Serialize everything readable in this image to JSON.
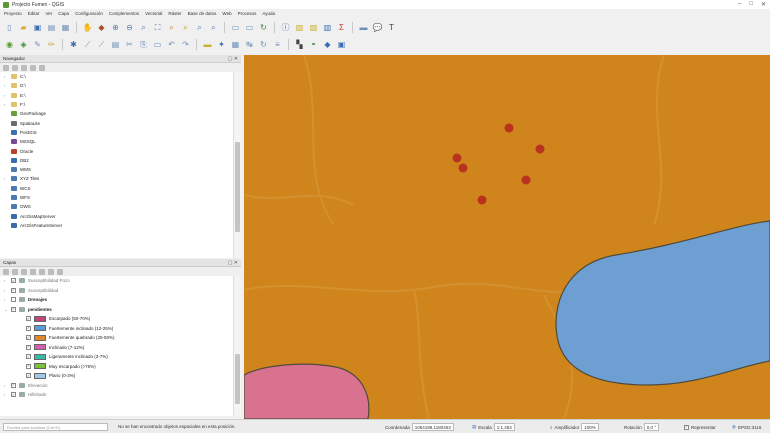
{
  "window": {
    "title": "Projecto Fumen - QGIS",
    "controls": [
      "–",
      "□",
      "✕"
    ]
  },
  "menu": [
    "Proyecto",
    "Editar",
    "Ver",
    "Capa",
    "Configuración",
    "Complementos",
    "Vectorial",
    "Ráster",
    "Base de datos",
    "Web",
    "Procesos",
    "Ayuda"
  ],
  "toolbar": {
    "row1": [
      {
        "icon": "new-project-icon",
        "glyph": "▯",
        "color": "#6d8fb8"
      },
      {
        "icon": "open-project-icon",
        "glyph": "▰",
        "color": "#d6a93a"
      },
      {
        "icon": "save-project-icon",
        "glyph": "▣",
        "color": "#3b6eb3"
      },
      {
        "icon": "print-layout-icon",
        "glyph": "▤",
        "color": "#6d8fb8"
      },
      {
        "icon": "layout-manager-icon",
        "glyph": "▦",
        "color": "#6d8fb8"
      },
      {
        "icon": "pan-icon",
        "glyph": "✋",
        "color": "#c9a33a"
      },
      {
        "icon": "pan-to-selection-icon",
        "glyph": "◆",
        "color": "#a94e2a"
      },
      {
        "icon": "zoom-in-icon",
        "glyph": "⊕",
        "color": "#5b80b0"
      },
      {
        "icon": "zoom-out-icon",
        "glyph": "⊖",
        "color": "#5b80b0"
      },
      {
        "icon": "zoom-rubber-icon",
        "glyph": "⌕",
        "color": "#5b80b0"
      },
      {
        "icon": "zoom-full-icon",
        "glyph": "⛶",
        "color": "#3a6ea8"
      },
      {
        "icon": "zoom-layer-icon",
        "glyph": "⌕",
        "color": "#c8862e"
      },
      {
        "icon": "zoom-selection-icon",
        "glyph": "⌕",
        "color": "#b8a22e"
      },
      {
        "icon": "zoom-last-icon",
        "glyph": "⌕",
        "color": "#5b80b0"
      },
      {
        "icon": "zoom-next-icon",
        "glyph": "⌕",
        "color": "#5b80b0"
      },
      {
        "icon": "new-bookmark-icon",
        "glyph": "▭",
        "color": "#6d8fb8"
      },
      {
        "icon": "show-bookmarks-icon",
        "glyph": "▭",
        "color": "#6d8fb8"
      },
      {
        "icon": "refresh-icon",
        "glyph": "↻",
        "color": "#3b8a3b"
      },
      {
        "icon": "identify-icon",
        "glyph": "ⓘ",
        "color": "#3a6ea8"
      },
      {
        "icon": "select-features-icon",
        "glyph": "▨",
        "color": "#c8b02e"
      },
      {
        "icon": "deselect-icon",
        "glyph": "▧",
        "color": "#c8b02e"
      },
      {
        "icon": "field-calculator-icon",
        "glyph": "▥",
        "color": "#3b6eb3"
      },
      {
        "icon": "statistics-icon",
        "glyph": "Σ",
        "color": "#c03a2a"
      },
      {
        "icon": "measure-icon",
        "glyph": "▬",
        "color": "#6d8fb8"
      },
      {
        "icon": "map-tips-icon",
        "glyph": "💬",
        "color": "#c9a33a"
      },
      {
        "icon": "text-annotation-icon",
        "glyph": "T",
        "color": "#444"
      }
    ],
    "row2": [
      {
        "icon": "data-source-manager-icon",
        "glyph": "◉",
        "color": "#5a9a36"
      },
      {
        "icon": "new-layer-icon",
        "glyph": "◈",
        "color": "#3b8a3b"
      },
      {
        "icon": "digitize-icon",
        "glyph": "✎",
        "color": "#6d8fb8"
      },
      {
        "icon": "edit-pencil-icon",
        "glyph": "✏",
        "color": "#c9a33a"
      },
      {
        "icon": "add-feature-icon",
        "glyph": "✱",
        "color": "#3b6eb3"
      },
      {
        "icon": "vertex-tool-icon",
        "glyph": "⟋",
        "color": "#6d8fb8"
      },
      {
        "icon": "move-feature-icon",
        "glyph": "⟋",
        "color": "#6d8fb8"
      },
      {
        "icon": "delete-feature-icon",
        "glyph": "▤",
        "color": "#6d8fb8"
      },
      {
        "icon": "cut-features-icon",
        "glyph": "✂",
        "color": "#6d8fb8"
      },
      {
        "icon": "copy-features-icon",
        "glyph": "⎘",
        "color": "#6d8fb8"
      },
      {
        "icon": "paste-features-icon",
        "glyph": "▭",
        "color": "#6d8fb8"
      },
      {
        "icon": "undo-icon",
        "glyph": "↶",
        "color": "#6d8fb8"
      },
      {
        "icon": "redo-icon",
        "glyph": "↷",
        "color": "#6d8fb8"
      },
      {
        "icon": "label-tool-icon",
        "glyph": "▬",
        "color": "#c8b02e"
      },
      {
        "icon": "label-pin-icon",
        "glyph": "✦",
        "color": "#3b6eb3"
      },
      {
        "icon": "label-show-icon",
        "glyph": "▦",
        "color": "#6d8fb8"
      },
      {
        "icon": "label-move-icon",
        "glyph": "↹",
        "color": "#6d8fb8"
      },
      {
        "icon": "label-rotate-icon",
        "glyph": "↻",
        "color": "#6d8fb8"
      },
      {
        "icon": "label-change-icon",
        "glyph": "≡",
        "color": "#6d8fb8"
      },
      {
        "icon": "plugin-a-icon",
        "glyph": "▚",
        "color": "#444"
      },
      {
        "icon": "plugin-b-icon",
        "glyph": "◓",
        "color": "#3b8a3b"
      },
      {
        "icon": "plugin-c-icon",
        "glyph": "◆",
        "color": "#3b6eb3"
      },
      {
        "icon": "plugin-d-icon",
        "glyph": "▣",
        "color": "#3b6eb3"
      }
    ]
  },
  "browser_panel": {
    "title": "Navegador",
    "items": [
      {
        "label": "C:\\",
        "icon_color": "#e2c36b",
        "expand": "›"
      },
      {
        "label": "D:\\",
        "icon_color": "#e2c36b",
        "expand": "›"
      },
      {
        "label": "E:\\",
        "icon_color": "#e2c36b",
        "expand": "›"
      },
      {
        "label": "F:\\",
        "icon_color": "#e2c36b",
        "expand": "›"
      },
      {
        "label": "GeoPackage",
        "icon_color": "#6a9c3a",
        "expand": ""
      },
      {
        "label": "SpatiaLite",
        "icon_color": "#6b6b6b",
        "expand": ""
      },
      {
        "label": "PostGIS",
        "icon_color": "#3b6eb3",
        "expand": ""
      },
      {
        "label": "MSSQL",
        "icon_color": "#7a4a9a",
        "expand": ""
      },
      {
        "label": "Oracle",
        "icon_color": "#b8432a",
        "expand": ""
      },
      {
        "label": "DB2",
        "icon_color": "#3b6eb3",
        "expand": ""
      },
      {
        "label": "WMS",
        "icon_color": "#4a7ab0",
        "expand": ""
      },
      {
        "label": "XYZ Tiles",
        "icon_color": "#4a7ab0",
        "expand": "›"
      },
      {
        "label": "WCS",
        "icon_color": "#4a7ab0",
        "expand": ""
      },
      {
        "label": "WFS",
        "icon_color": "#4a7ab0",
        "expand": ""
      },
      {
        "label": "OWS",
        "icon_color": "#4a7ab0",
        "expand": ""
      },
      {
        "label": "ArcGisMapServer",
        "icon_color": "#3a6ea8",
        "expand": ""
      },
      {
        "label": "ArcGisFeatureServer",
        "icon_color": "#3a6ea8",
        "expand": ""
      }
    ]
  },
  "layers_panel": {
    "title": "Capas",
    "items": [
      {
        "label": "Susceptibilidad Pozo",
        "indent": 0,
        "checked": true,
        "kind": "layer",
        "style": "muted"
      },
      {
        "label": "Susceptibilidad",
        "indent": 0,
        "checked": true,
        "kind": "layer",
        "style": "muted"
      },
      {
        "label": "Drenajes",
        "indent": 0,
        "checked": false,
        "kind": "layer",
        "style": "bold"
      },
      {
        "label": "pendientes",
        "indent": 0,
        "checked": true,
        "kind": "group",
        "style": "bold"
      },
      {
        "label": "Escarpado (50-70%)",
        "indent": 1,
        "checked": true,
        "kind": "class",
        "swatch": "#c0447c"
      },
      {
        "label": "Fuertemente inclinado (12-25%)",
        "indent": 1,
        "checked": true,
        "kind": "class",
        "swatch": "#5e9ad6"
      },
      {
        "label": "Fuertemente quebrado (25-50%)",
        "indent": 1,
        "checked": true,
        "kind": "class",
        "swatch": "#e08a2a"
      },
      {
        "label": "Inclinado (7-12%)",
        "indent": 1,
        "checked": true,
        "kind": "class",
        "swatch": "#d65fb0"
      },
      {
        "label": "Ligeramente inclinado (3-7%)",
        "indent": 1,
        "checked": true,
        "kind": "class",
        "swatch": "#3bb8a8"
      },
      {
        "label": "Muy escarpado (>75%)",
        "indent": 1,
        "checked": true,
        "kind": "class",
        "swatch": "#7fc23a"
      },
      {
        "label": "Plano (0-3%)",
        "indent": 1,
        "checked": true,
        "kind": "class",
        "swatch": "#a0c8e8"
      },
      {
        "label": "Elevación",
        "indent": 0,
        "checked": true,
        "kind": "layer",
        "style": "muted"
      },
      {
        "label": "Hillshade",
        "indent": 0,
        "checked": true,
        "kind": "layer",
        "style": "muted"
      }
    ]
  },
  "map": {
    "colors": {
      "background": "#cf851c",
      "blue_zone": "#6e9fd3",
      "pink_zone": "#d9728f",
      "point": "#b8321f",
      "outline": "#4e4a3a"
    }
  },
  "status": {
    "search_placeholder": "Escriba para localizar (Ctrl+K)",
    "message": "No se han encontrado objetos espaciales en esta posición.",
    "coordinate_label": "Coordenada",
    "coordinate_value": "1054199,1180453",
    "scale_label": "Escala",
    "scale_value": "1:1.453",
    "magnifier_label": "Amplificador",
    "magnifier_value": "100%",
    "rotation_label": "Rotación",
    "rotation_value": "0,0 °",
    "render_label": "Representar",
    "crs_label": "EPSG:3116"
  }
}
